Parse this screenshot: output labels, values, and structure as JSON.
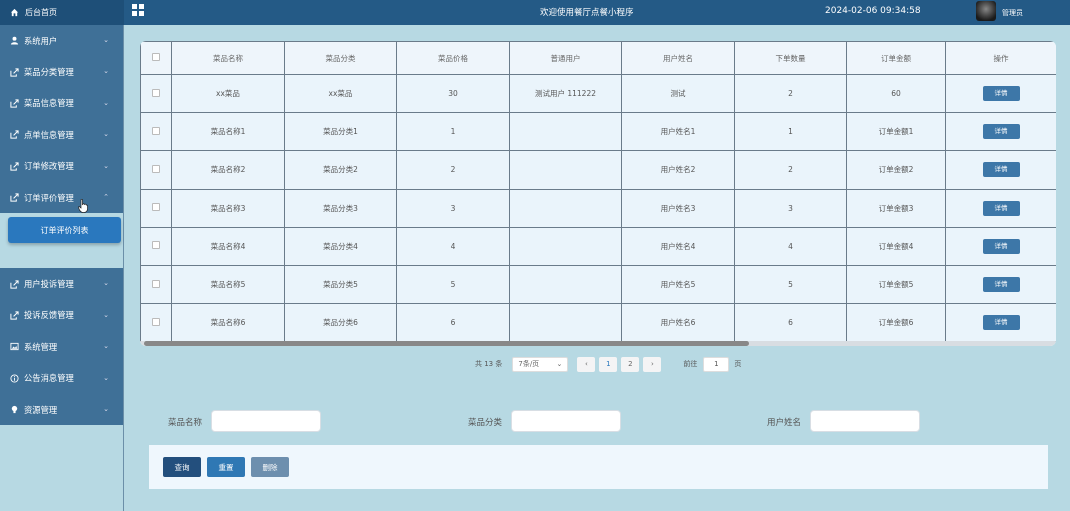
{
  "header": {
    "home_label": "后台首页",
    "title": "欢迎使用餐厅点餐小程序",
    "datetime": "2024-02-06 09:34:58",
    "username": "管理员"
  },
  "sidebar": {
    "items": [
      {
        "label": "系统用户",
        "icon": "user-icon"
      },
      {
        "label": "菜品分类管理",
        "icon": "share-icon"
      },
      {
        "label": "菜品信息管理",
        "icon": "share-icon"
      },
      {
        "label": "点单信息管理",
        "icon": "share-icon"
      },
      {
        "label": "订单修改管理",
        "icon": "share-icon"
      },
      {
        "label": "订单评价管理",
        "icon": "share-icon",
        "expanded": true
      },
      {
        "label": "用户投诉管理",
        "icon": "share-icon"
      },
      {
        "label": "投诉反馈管理",
        "icon": "share-icon"
      },
      {
        "label": "系统管理",
        "icon": "picture-icon"
      },
      {
        "label": "公告消息管理",
        "icon": "info-icon"
      },
      {
        "label": "资源管理",
        "icon": "bulb-icon"
      }
    ],
    "sub_item": "订单评价列表"
  },
  "table": {
    "headers": [
      "菜品名称",
      "菜品分类",
      "菜品价格",
      "普通用户",
      "用户姓名",
      "下单数量",
      "订单金额",
      "操作"
    ],
    "rows": [
      [
        "xx菜品",
        "xx菜品",
        "30",
        "测试用户 111222",
        "测试",
        "2",
        "60"
      ],
      [
        "菜品名称1",
        "菜品分类1",
        "1",
        "",
        "用户姓名1",
        "1",
        "订单金额1"
      ],
      [
        "菜品名称2",
        "菜品分类2",
        "2",
        "",
        "用户姓名2",
        "2",
        "订单金额2"
      ],
      [
        "菜品名称3",
        "菜品分类3",
        "3",
        "",
        "用户姓名3",
        "3",
        "订单金额3"
      ],
      [
        "菜品名称4",
        "菜品分类4",
        "4",
        "",
        "用户姓名4",
        "4",
        "订单金额4"
      ],
      [
        "菜品名称5",
        "菜品分类5",
        "5",
        "",
        "用户姓名5",
        "5",
        "订单金额5"
      ],
      [
        "菜品名称6",
        "菜品分类6",
        "6",
        "",
        "用户姓名6",
        "6",
        "订单金额6"
      ]
    ],
    "detail_label": "详情"
  },
  "pagination": {
    "total": "共 13 条",
    "page_size": "7条/页",
    "prev": "‹",
    "pages": [
      "1",
      "2"
    ],
    "current_page": "1",
    "next": "›",
    "goto_label": "前往",
    "goto_value": "1",
    "page_suffix": "页"
  },
  "search": {
    "fields": [
      {
        "label": "菜品名称",
        "value": ""
      },
      {
        "label": "菜品分类",
        "value": ""
      },
      {
        "label": "用户姓名",
        "value": ""
      }
    ]
  },
  "actions": {
    "query": "查询",
    "reset": "重置",
    "delete": "删除"
  },
  "colors": {
    "topbar": "#245a86",
    "sidebar_menu": "#3f7097",
    "background": "#b7d9e3",
    "active_sub": "#2a78be",
    "query_btn": "#234f7d",
    "reset_btn": "#2f78b4",
    "delete_btn": "#6d8fae"
  }
}
